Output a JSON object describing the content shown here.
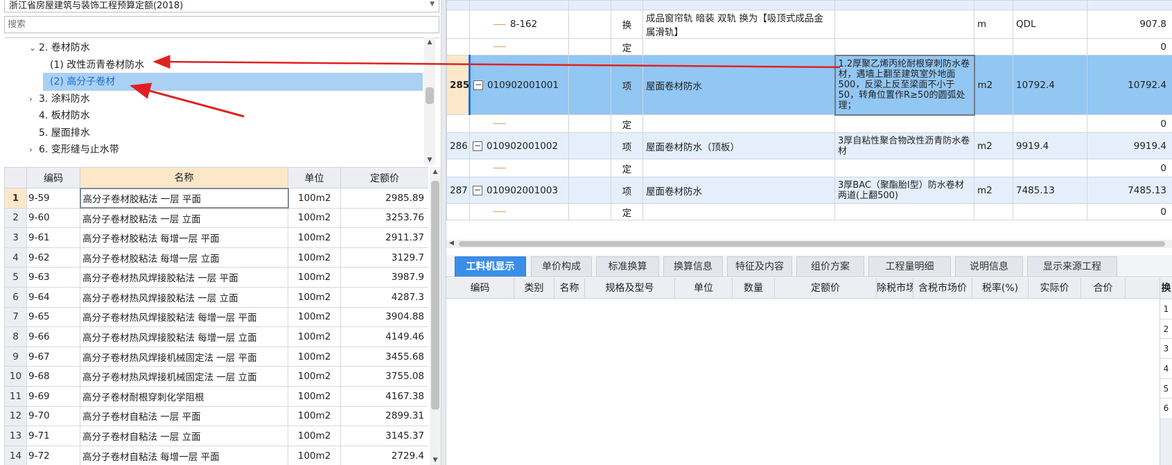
{
  "left": {
    "selector_value": "浙江省房屋建筑与装饰工程预算定额(2018)",
    "search_placeholder": "搜索",
    "tree": [
      {
        "label": "2. 卷材防水",
        "chev": "⌄",
        "indent": 36,
        "selected": false
      },
      {
        "label": "(1) 改性沥青卷材防水",
        "chev": "",
        "indent": 66,
        "selected": false
      },
      {
        "label": "(2) 高分子卷材",
        "chev": "",
        "indent": 66,
        "selected": true
      },
      {
        "label": "3. 涂料防水",
        "chev": "›",
        "indent": 36,
        "selected": false
      },
      {
        "label": "4. 板材防水",
        "chev": "",
        "indent": 36,
        "selected": false
      },
      {
        "label": "5. 屋面排水",
        "chev": "",
        "indent": 36,
        "selected": false
      },
      {
        "label": "6. 变形缝与止水带",
        "chev": "›",
        "indent": 36,
        "selected": false
      }
    ],
    "quota_headers": {
      "code": "编码",
      "name": "名称",
      "unit": "单位",
      "price": "定额价"
    },
    "quota_rows": [
      {
        "no": "1",
        "code": "9-59",
        "name": "高分子卷材胶粘法 一层 平面",
        "unit": "100m2",
        "price": "2985.89"
      },
      {
        "no": "2",
        "code": "9-60",
        "name": "高分子卷材胶粘法 一层 立面",
        "unit": "100m2",
        "price": "3253.76"
      },
      {
        "no": "3",
        "code": "9-61",
        "name": "高分子卷材胶粘法 每增一层 平面",
        "unit": "100m2",
        "price": "2911.37"
      },
      {
        "no": "4",
        "code": "9-62",
        "name": "高分子卷材胶粘法 每增一层 立面",
        "unit": "100m2",
        "price": "3129.7"
      },
      {
        "no": "5",
        "code": "9-63",
        "name": "高分子卷材热风焊接胶粘法 一层 平面",
        "unit": "100m2",
        "price": "3987.9"
      },
      {
        "no": "6",
        "code": "9-64",
        "name": "高分子卷材热风焊接胶粘法 一层 立面",
        "unit": "100m2",
        "price": "4287.3"
      },
      {
        "no": "7",
        "code": "9-65",
        "name": "高分子卷材热风焊接胶粘法 每增一层 平面",
        "unit": "100m2",
        "price": "3904.88"
      },
      {
        "no": "8",
        "code": "9-66",
        "name": "高分子卷材热风焊接胶粘法 每增一层 立面",
        "unit": "100m2",
        "price": "4149.46"
      },
      {
        "no": "9",
        "code": "9-67",
        "name": "高分子卷材热风焊接机械固定法 一层 平面",
        "unit": "100m2",
        "price": "3455.68"
      },
      {
        "no": "10",
        "code": "9-68",
        "name": "高分子卷材热风焊接机械固定法 一层 立面",
        "unit": "100m2",
        "price": "3755.08"
      },
      {
        "no": "11",
        "code": "9-69",
        "name": "高分子卷材耐根穿刺化学阻根",
        "unit": "100m2",
        "price": "4167.38"
      },
      {
        "no": "12",
        "code": "9-70",
        "name": "高分子卷材自粘法 一层 平面",
        "unit": "100m2",
        "price": "2899.31"
      },
      {
        "no": "13",
        "code": "9-71",
        "name": "高分子卷材自粘法 一层 立面",
        "unit": "100m2",
        "price": "3145.37"
      },
      {
        "no": "14",
        "code": "9-72",
        "name": "高分子卷材自粘法 每增一层 平面",
        "unit": "100m2",
        "price": "2729.4"
      }
    ]
  },
  "right": {
    "bill_rows": [
      {
        "kind": "item",
        "rn": "",
        "code": "",
        "fee": "",
        "type": "",
        "name": "",
        "feat": "",
        "unit": "",
        "expr": "",
        "qty": ""
      },
      {
        "kind": "sub",
        "rn": "",
        "code": "8-162",
        "fee": "",
        "type": "换",
        "name": "成品窗帘轨 暗装 双轨  换为【吸顶式成品金属滑轨】",
        "feat": "",
        "unit": "m",
        "expr": "QDL",
        "qty": "907.8"
      },
      {
        "kind": "sub",
        "rn": "",
        "code": "",
        "fee": "",
        "type": "定",
        "name": "",
        "feat": "",
        "unit": "",
        "expr": "",
        "qty": "0"
      },
      {
        "kind": "sel",
        "rn": "285",
        "code": "010902001001",
        "fee": "",
        "type": "项",
        "name": "屋面卷材防水",
        "feat": "1.2厚聚乙烯丙纶耐根穿刺防水卷材，遇墙上翻至建筑室外地面500，反梁上反至梁面不小于50，转角位置作R≥50的圆弧处理；",
        "unit": "m2",
        "expr": "10792.4",
        "qty": "10792.4"
      },
      {
        "kind": "sub",
        "rn": "",
        "code": "",
        "fee": "",
        "type": "定",
        "name": "",
        "feat": "",
        "unit": "",
        "expr": "",
        "qty": "0"
      },
      {
        "kind": "item",
        "rn": "286",
        "code": "010902001002",
        "fee": "",
        "type": "项",
        "name": "屋面卷材防水（顶板）",
        "feat": "3厚自粘性聚合物改性沥青防水卷材",
        "unit": "m2",
        "expr": "9919.4",
        "qty": "9919.4"
      },
      {
        "kind": "sub",
        "rn": "",
        "code": "",
        "fee": "",
        "type": "定",
        "name": "",
        "feat": "",
        "unit": "",
        "expr": "",
        "qty": "0"
      },
      {
        "kind": "item",
        "rn": "287",
        "code": "010902001003",
        "fee": "",
        "type": "项",
        "name": "屋面卷材防水",
        "feat": "3厚BAC（聚酯胎I型）防水卷材两道(上翻500)",
        "unit": "m2",
        "expr": "7485.13",
        "qty": "7485.13"
      },
      {
        "kind": "sub",
        "rn": "",
        "code": "",
        "fee": "",
        "type": "定",
        "name": "",
        "feat": "",
        "unit": "",
        "expr": "",
        "qty": "0"
      }
    ],
    "tabs": [
      "工料机显示",
      "单价构成",
      "标准换算",
      "换算信息",
      "特征及内容",
      "组价方案",
      "工程量明细",
      "说明信息",
      "显示来源工程"
    ],
    "active_tab": 0,
    "detail_headers": [
      "编码",
      "类别",
      "名称",
      "规格及型号",
      "单位",
      "数量",
      "定额价",
      "除税市场价",
      "含税市场价",
      "税率(%)",
      "实际价",
      "合价"
    ],
    "side_header": "换",
    "side_numbers": [
      "1",
      "2",
      "3",
      "4",
      "5",
      "6"
    ]
  },
  "colors": {
    "selection_blue": "#92c6f3",
    "tab_active": "#3b8ee8",
    "arrow_red": "#e02020"
  }
}
